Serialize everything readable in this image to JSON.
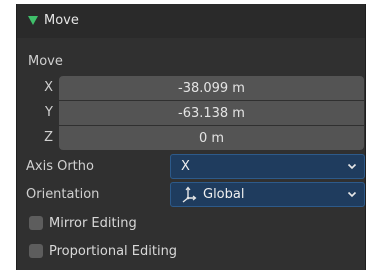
{
  "panel": {
    "title": "Move",
    "section_label": "Move"
  },
  "move": {
    "axes": [
      {
        "label": "X",
        "value": "-38.099 m"
      },
      {
        "label": "Y",
        "value": "-63.138 m"
      },
      {
        "label": "Z",
        "value": "0 m"
      }
    ]
  },
  "axis_ortho": {
    "label": "Axis Ortho",
    "value": "X"
  },
  "orientation": {
    "label": "Orientation",
    "value": "Global",
    "icon": "global-orientation-icon"
  },
  "options": {
    "mirror_editing": {
      "label": "Mirror Editing",
      "checked": false
    },
    "proportional_editing": {
      "label": "Proportional Editing",
      "checked": false
    }
  },
  "colors": {
    "panel_bg": "#303030",
    "field_bg": "#545454",
    "dropdown_bg": "#1f3c5e",
    "accent_green": "#3fbf6a"
  }
}
